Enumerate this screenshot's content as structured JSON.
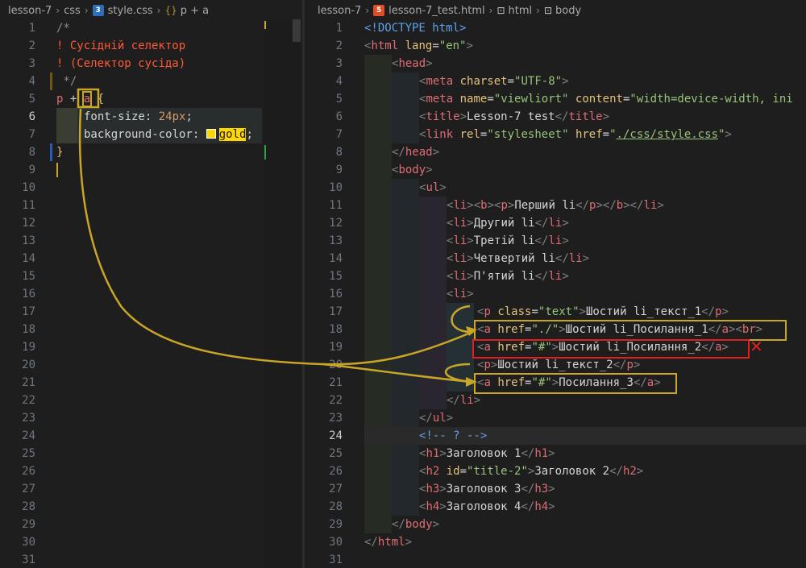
{
  "left": {
    "breadcrumb": [
      "lesson-7",
      "css",
      "style.css",
      "p + a"
    ],
    "line_numbers": [
      "1",
      "2",
      "3",
      "4",
      "5",
      "6",
      "7",
      "8",
      "9",
      "10",
      "11",
      "12",
      "13",
      "14",
      "15",
      "16",
      "17",
      "18",
      "19",
      "20",
      "21",
      "22",
      "23",
      "24",
      "25",
      "26",
      "27",
      "28",
      "29",
      "30",
      "31"
    ],
    "code": {
      "l1": "/*",
      "l2": "! Сусідній селектор",
      "l3": "! (Селектор сусіда)",
      "l4": " */",
      "l5_p": "p",
      "l5_plus": " + ",
      "l5_a": "a",
      "l5_brace": " {",
      "l6_prop": "font-size:",
      "l6_val": " 24px",
      "l6_semi": ";",
      "l7_prop": "background-color: ",
      "l7_val": "gold",
      "l7_semi": ";",
      "l8": "}"
    }
  },
  "right": {
    "breadcrumb": [
      "lesson-7",
      "lesson-7_test.html",
      "html",
      "body"
    ],
    "line_numbers": [
      "1",
      "2",
      "3",
      "4",
      "5",
      "6",
      "7",
      "8",
      "9",
      "10",
      "11",
      "12",
      "13",
      "14",
      "15",
      "16",
      "17",
      "18",
      "19",
      "20",
      "21",
      "22",
      "23",
      "24",
      "25",
      "26",
      "27",
      "28",
      "29",
      "30",
      "31"
    ],
    "code": {
      "doctype": "<!DOCTYPE html>",
      "html_lang": "en",
      "meta_charset": "UTF-8",
      "meta_name": "viewliort",
      "meta_content": "width=device-width, ini",
      "title_text": "Lesson-7 test",
      "link_rel": "stylesheet",
      "link_href": "./css/style.css",
      "li1_text": "Перший li",
      "li2_text": "Другий li",
      "li3_text": "Третій li",
      "li4_text": "Четвертий li",
      "li5_text": "П'ятий li",
      "p_class": "text",
      "p1_text": "Шостий li_текст_1",
      "a1_href": "./",
      "a1_text": "Шостий li_Посилання_1",
      "a2_href": "#",
      "a2_text": "Шостий li_Посилання_2",
      "p2_text": "Шостий li_текст_2",
      "a3_href": "#",
      "a3_text": "Посилання_3",
      "comment": "<!-- ? -->",
      "h1_text": "Заголовок 1",
      "h2_id": "title-2",
      "h2_text": "Заголовок 2",
      "h3_text": "Заголовок 3",
      "h4_text": "Заголовок 4"
    },
    "annotations": {
      "mismatch_mark": "✕"
    }
  },
  "colors": {
    "highlight_yellow": "#c9a627",
    "error_red": "#e02020",
    "gold": "#ffd700",
    "tag": "#e06c75",
    "attr": "#e5c07b",
    "string": "#98c379"
  }
}
